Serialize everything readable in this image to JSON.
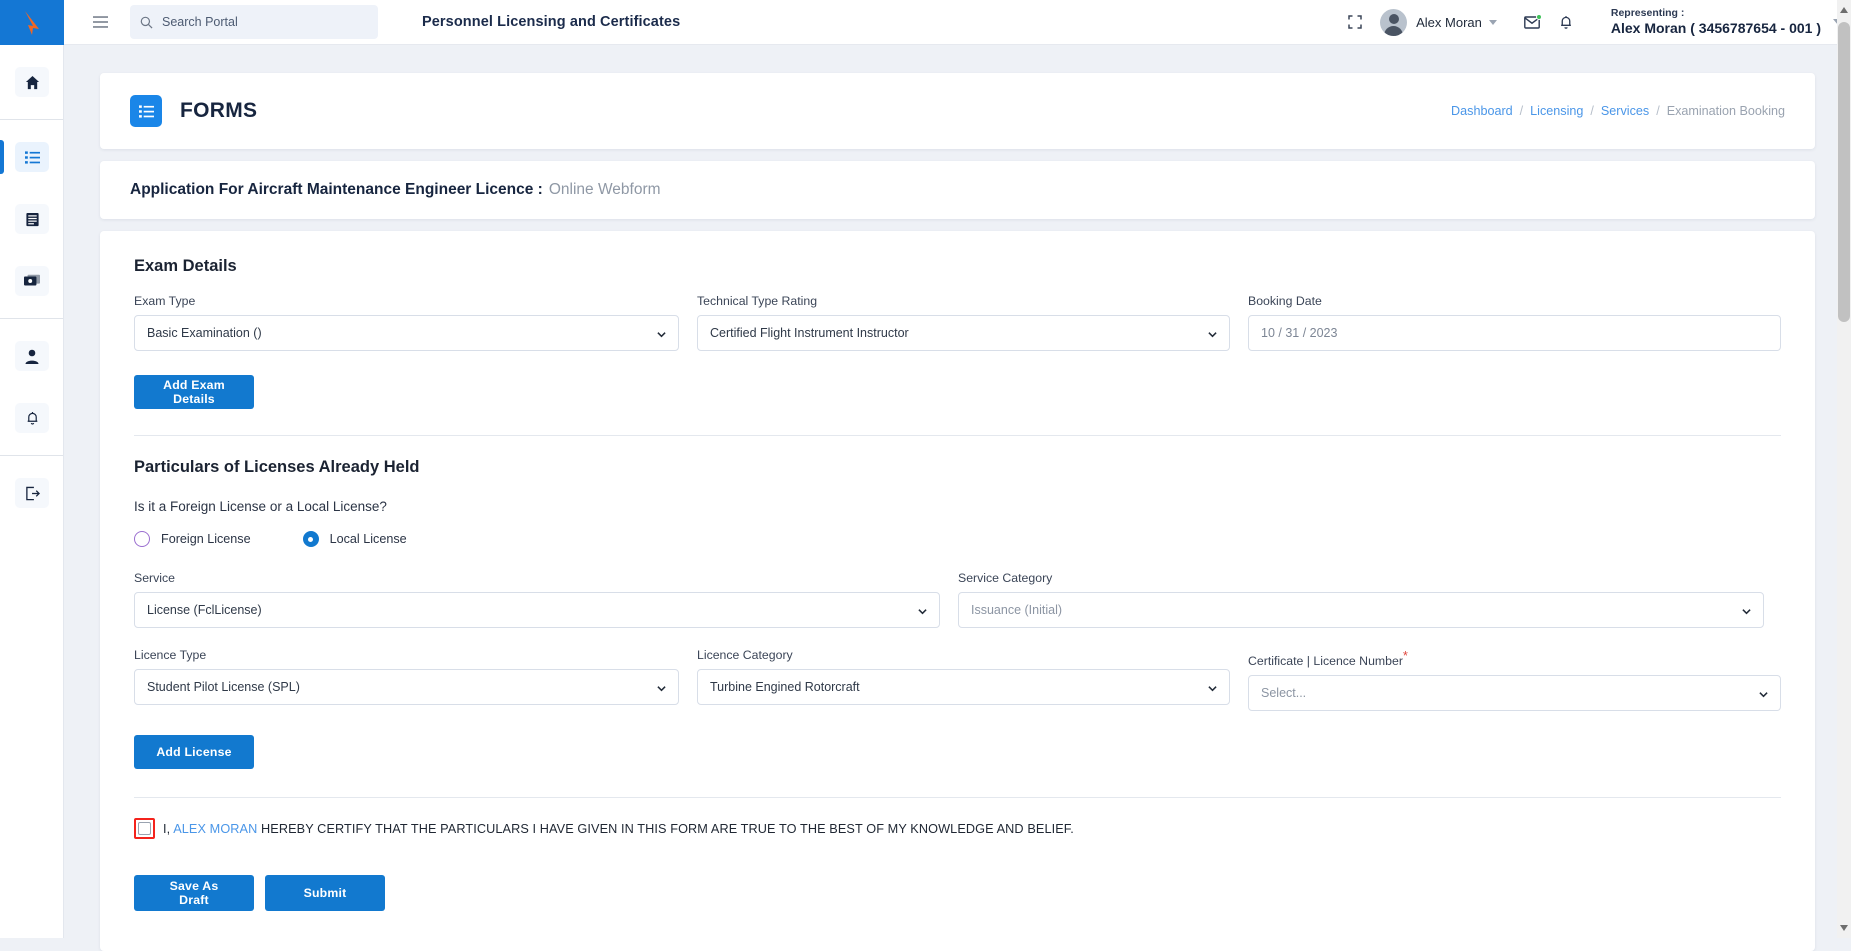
{
  "topbar": {
    "hamburger_icon": "menu-icon",
    "search": {
      "icon": "search-icon",
      "placeholder": "Search Portal",
      "value": ""
    },
    "portal_title": "Personnel Licensing and Certificates",
    "fullscreen_icon": "fullscreen-icon",
    "avatar_icon": "avatar",
    "user_name": "Alex Moran",
    "user_caret_icon": "chevron-down-icon",
    "mail_icon": "mail-icon",
    "bell_icon": "bell-icon",
    "representing_label": "Representing :",
    "representing_value": "Alex Moran ( 3456787654 - 001 )",
    "representing_caret_icon": "chevron-down-icon"
  },
  "sidebar": {
    "logo_icon": "brand-logo-icon",
    "items": [
      {
        "name": "home",
        "icon": "home-icon",
        "active": false
      },
      {
        "name": "forms",
        "icon": "list-icon",
        "active": true
      },
      {
        "name": "documents",
        "icon": "document-icon",
        "active": false
      },
      {
        "name": "payments",
        "icon": "card-icon",
        "active": false
      },
      {
        "name": "profile",
        "icon": "user-icon",
        "active": false
      },
      {
        "name": "notifications",
        "icon": "bell-icon",
        "active": false
      },
      {
        "name": "logout",
        "icon": "logout-icon",
        "active": false
      }
    ]
  },
  "header": {
    "icon": "forms-list-icon",
    "title": "FORMS",
    "breadcrumb": [
      {
        "label": "Dashboard",
        "current": false
      },
      {
        "label": "Licensing",
        "current": false
      },
      {
        "label": "Services",
        "current": false
      },
      {
        "label": "Examination Booking",
        "current": true
      }
    ],
    "separator": "/"
  },
  "application": {
    "title": "Application For Aircraft Maintenance Engineer Licence :",
    "subtitle": "Online Webform"
  },
  "exam_details": {
    "section_title": "Exam Details",
    "exam_type": {
      "label": "Exam Type",
      "value": "Basic Examination ()"
    },
    "technical_type_rating": {
      "label": "Technical Type Rating",
      "value": "Certified Flight Instrument Instructor"
    },
    "booking_date": {
      "label": "Booking Date",
      "value": "10 / 31 / 2023"
    },
    "add_button": "Add Exam Details"
  },
  "licenses": {
    "section_title": "Particulars of Licenses Already Held",
    "question": "Is it a Foreign License or a Local License?",
    "options": [
      {
        "label": "Foreign License",
        "selected": false
      },
      {
        "label": "Local License",
        "selected": true
      }
    ],
    "service": {
      "label": "Service",
      "value": "License (FclLicense)"
    },
    "service_category": {
      "label": "Service Category",
      "value": "Issuance (Initial)"
    },
    "licence_type": {
      "label": "Licence Type",
      "value": "Student Pilot License (SPL)"
    },
    "licence_category": {
      "label": "Licence Category",
      "value": "Turbine Engined Rotorcraft"
    },
    "certificate_number": {
      "label": "Certificate | Licence Number",
      "required_marker": "*",
      "value": "Select..."
    },
    "add_button": "Add License"
  },
  "certify": {
    "checkbox_checked": false,
    "prefix": "I, ",
    "name": "ALEX MORAN",
    "statement": " HEREBY CERTIFY THAT THE PARTICULARS I HAVE GIVEN IN THIS FORM ARE TRUE TO THE BEST OF MY KNOWLEDGE AND BELIEF."
  },
  "actions": {
    "save_draft": "Save As Draft",
    "submit": "Submit"
  },
  "colors": {
    "accent": "#1279cf",
    "brand_blue": "#1477d4",
    "link": "#4a96e8",
    "highlight_red": "#f4231c",
    "radio_unselected": "#9b6fd0"
  }
}
